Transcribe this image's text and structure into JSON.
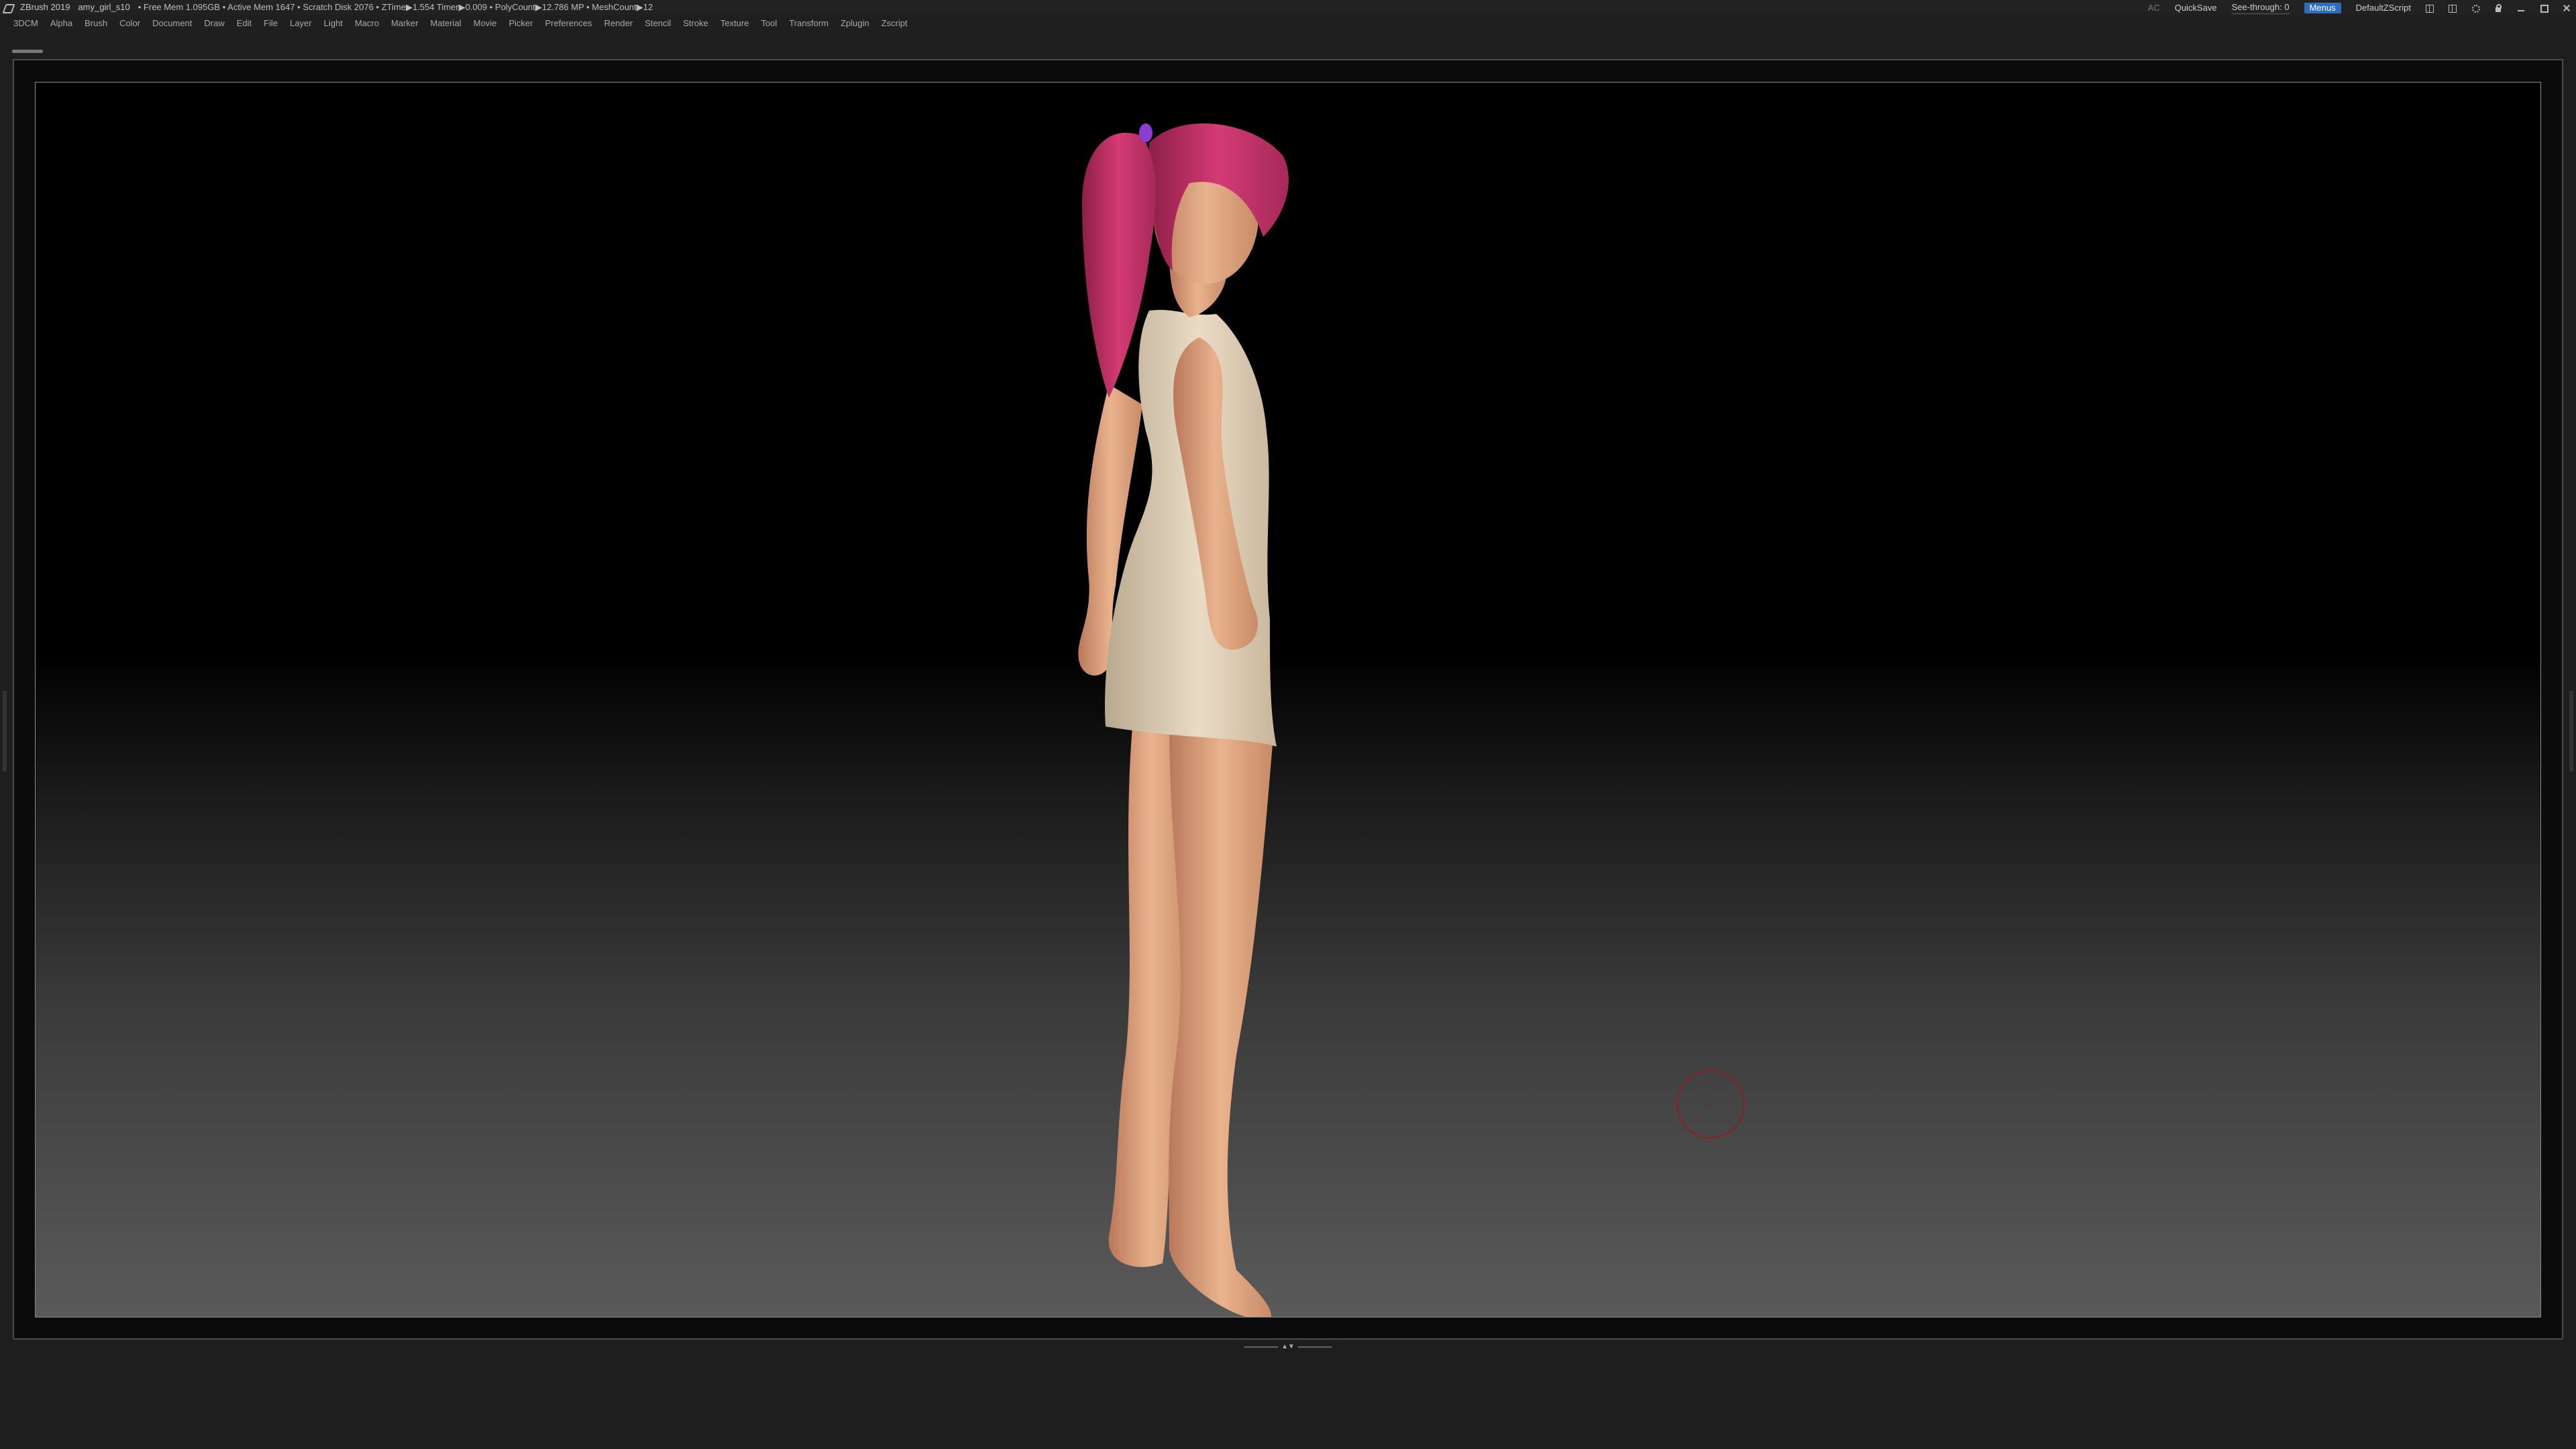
{
  "titlebar": {
    "app_name": "ZBrush 2019",
    "file_name": "amy_girl_s10",
    "stats": "• Free Mem 1.095GB • Active Mem 1647 • Scratch Disk 2076 • ZTime▶1.554 Timer▶0.009 • PolyCount▶12.786 MP • MeshCount▶12",
    "ac_label": "AC",
    "quicksave_label": "QuickSave",
    "see_through_label": "See-through: 0",
    "see_through_value": 0,
    "menus_label": "Menus",
    "script_label": "DefaultZScript",
    "icons": [
      "layout-icon",
      "layout-icon",
      "gear-icon",
      "lock-icon",
      "minimize-icon",
      "maximize-icon",
      "close-icon"
    ],
    "accent_color": "#2f6dbf"
  },
  "menubar": {
    "items": [
      "3DCM",
      "Alpha",
      "Brush",
      "Color",
      "Document",
      "Draw",
      "Edit",
      "File",
      "Layer",
      "Light",
      "Macro",
      "Marker",
      "Material",
      "Movie",
      "Picker",
      "Preferences",
      "Render",
      "Stencil",
      "Stroke",
      "Texture",
      "Tool",
      "Transform",
      "Zplugin",
      "Zscript"
    ]
  },
  "canvas": {
    "model_colors": {
      "hair": "#c8336b",
      "skin": "#e8b08a",
      "dress": "#e6d6bf",
      "hair_tie": "#8a3dd0"
    },
    "cursor_color": "#8a2020"
  }
}
